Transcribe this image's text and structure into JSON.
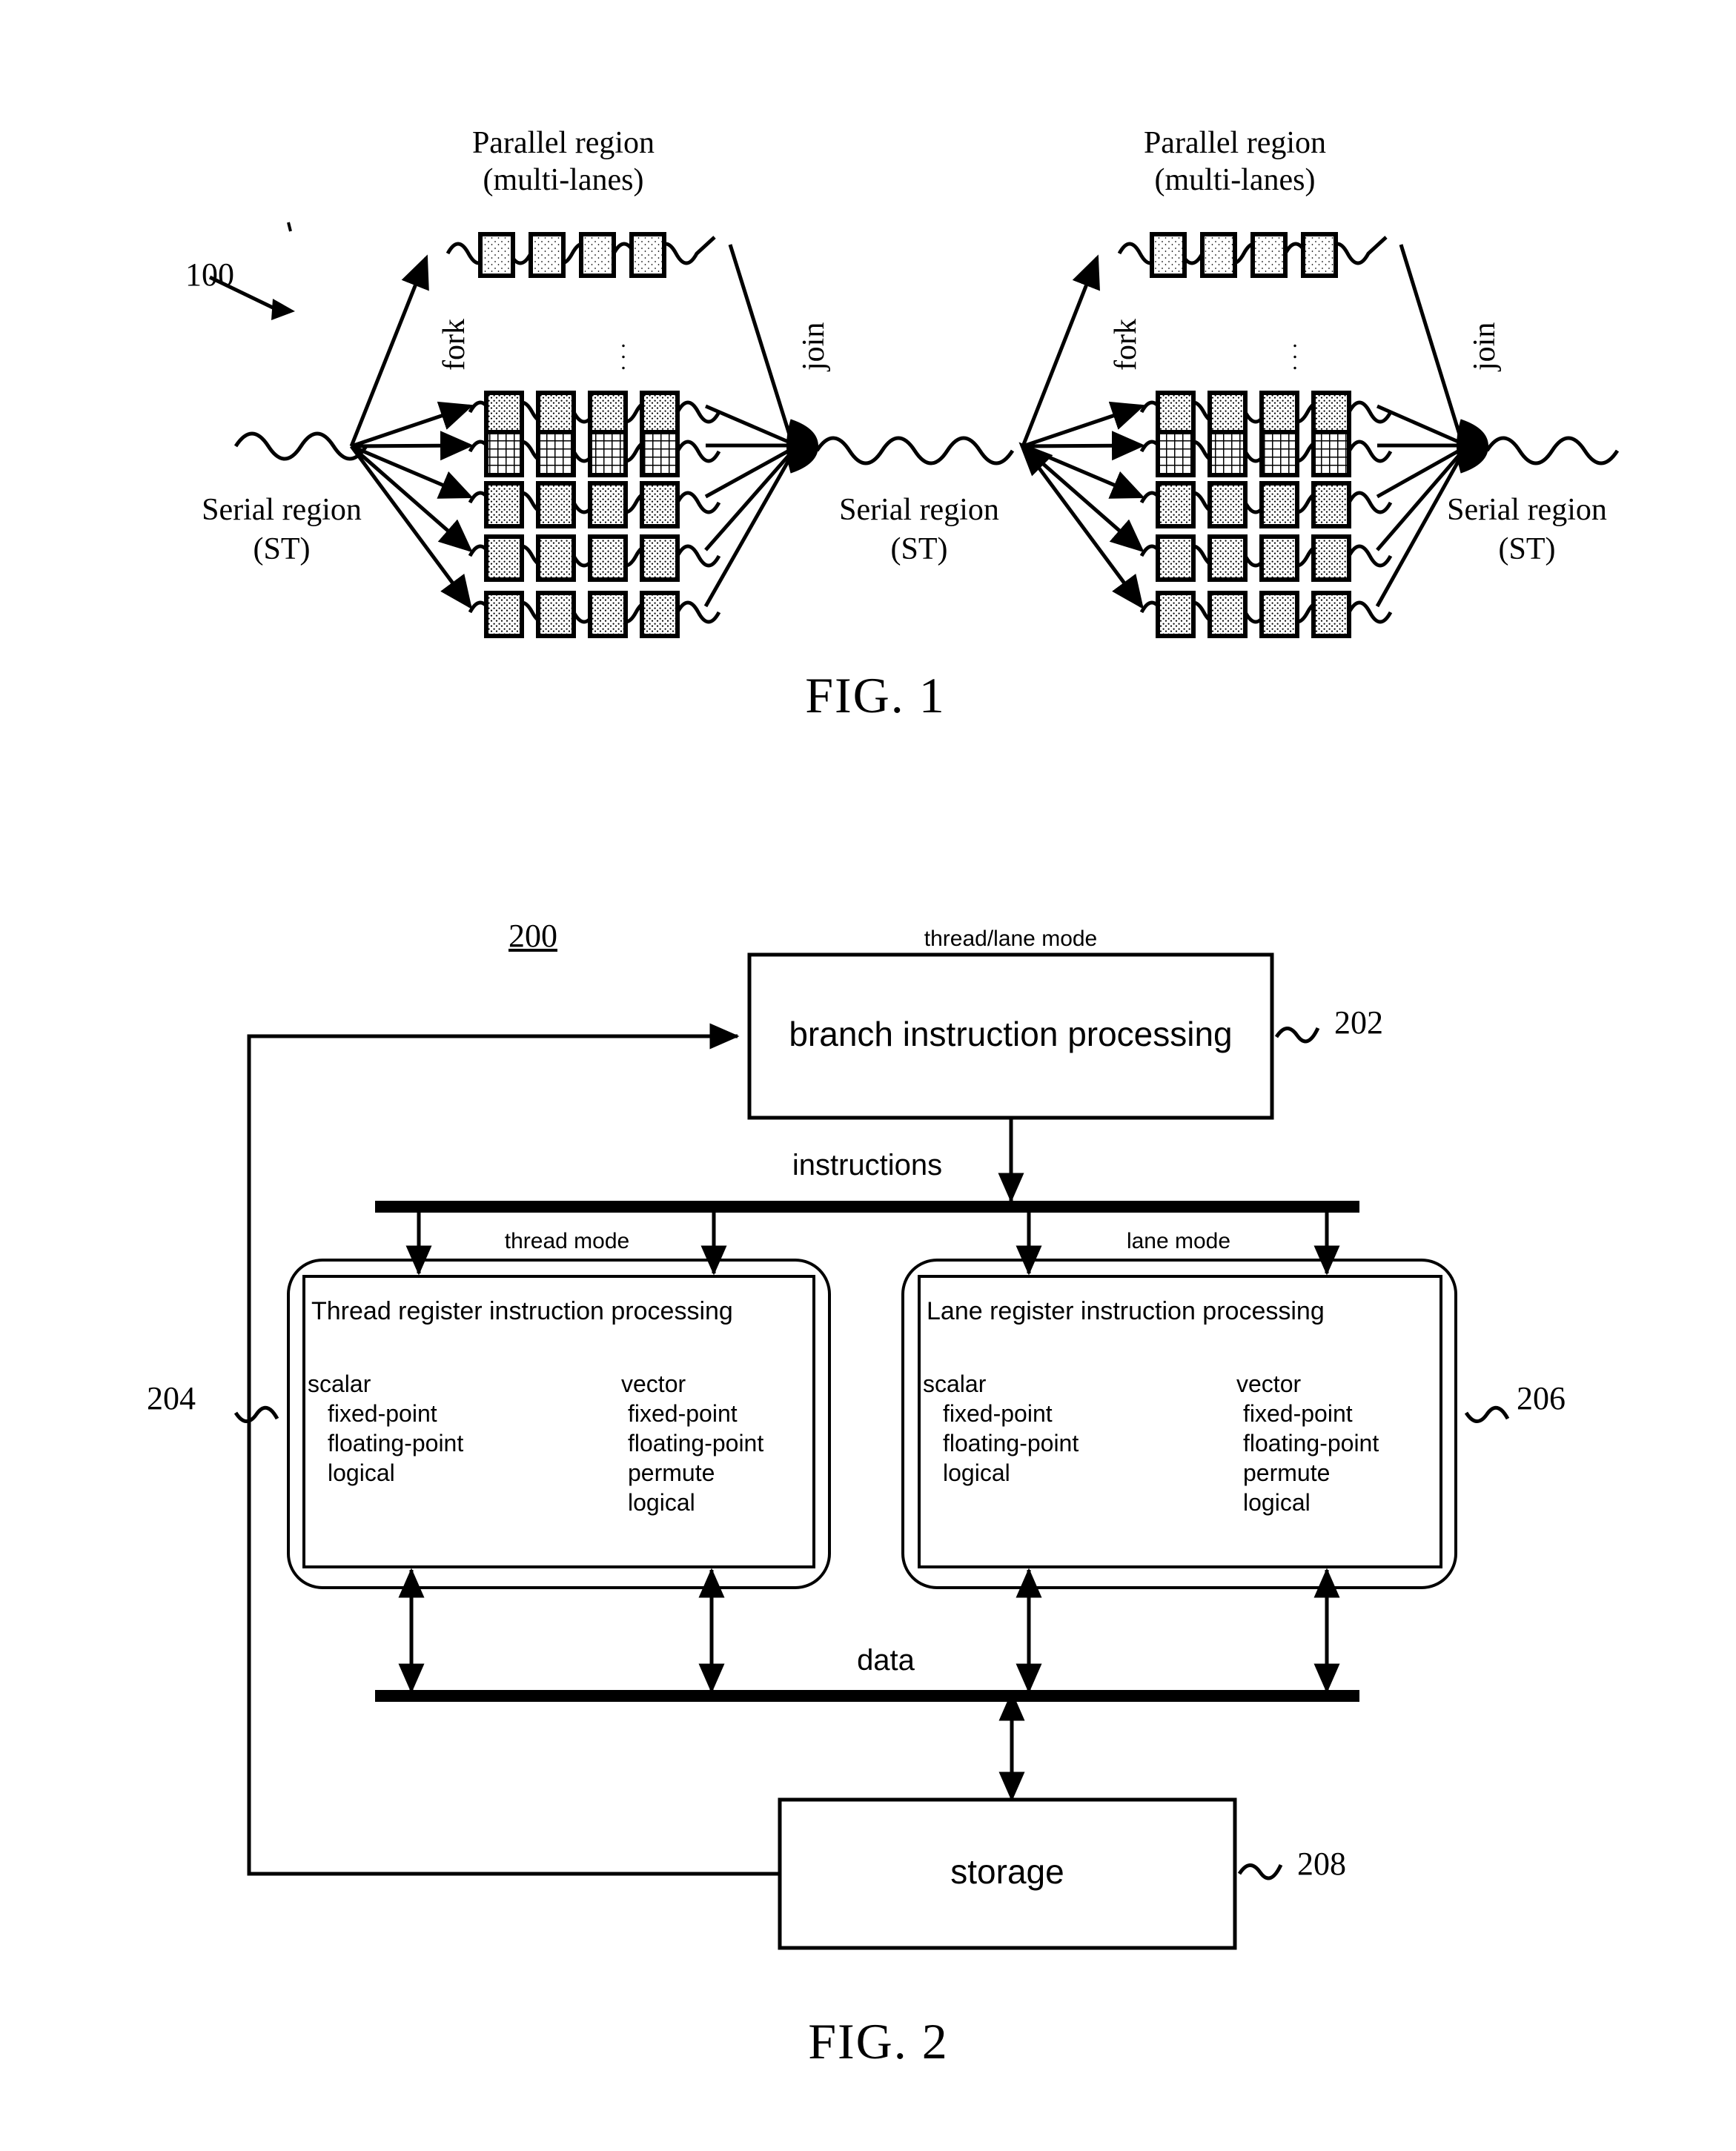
{
  "figure1": {
    "ref_number": "100",
    "fig_caption": "FIG. 1",
    "parallel_region_line1": "Parallel region",
    "parallel_region_line2": "(multi-lanes)",
    "serial_region_line1": "Serial region",
    "serial_region_line2": "(ST)",
    "fork_label": "fork",
    "join_label": "join",
    "vertical_ellipsis": "⋮",
    "lane_rows": [
      {
        "fill": "light-dots",
        "count": 4
      },
      {
        "fill": "dots",
        "count": 4
      },
      {
        "fill": "grid",
        "count": 4
      },
      {
        "fill": "dots",
        "count": 4
      },
      {
        "fill": "dots",
        "count": 4
      },
      {
        "fill": "dots",
        "count": 4
      }
    ],
    "groups": [
      {
        "name": "group-left"
      },
      {
        "name": "group-right"
      }
    ]
  },
  "figure2": {
    "ref_number": "200",
    "fig_caption": "FIG. 2",
    "branch_block": {
      "label": "branch instruction processing",
      "ref": "202",
      "top_label": "thread/lane mode"
    },
    "instructions_bus_label": "instructions",
    "data_bus_label": "data",
    "thread_block": {
      "mode_label": "thread mode",
      "title": "Thread register instruction processing",
      "ref": "204",
      "col1_header": "scalar",
      "col1_items": [
        "fixed-point",
        "floating-point",
        "logical"
      ],
      "col2_header": "vector",
      "col2_items": [
        "fixed-point",
        "floating-point",
        "permute",
        "logical"
      ]
    },
    "lane_block": {
      "mode_label": "lane mode",
      "title": "Lane register instruction processing",
      "ref": "206",
      "col1_header": "scalar",
      "col1_items": [
        "fixed-point",
        "floating-point",
        "logical"
      ],
      "col2_header": "vector",
      "col2_items": [
        "fixed-point",
        "floating-point",
        "permute",
        "logical"
      ]
    },
    "storage_block": {
      "label": "storage",
      "ref": "208"
    }
  },
  "colors": {
    "ink": "#000000",
    "paper": "#ffffff"
  }
}
